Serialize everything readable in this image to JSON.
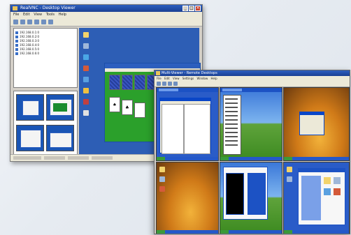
{
  "back_window": {
    "title": "RealVNC - Desktop Viewer",
    "menu": [
      "File",
      "Edit",
      "View",
      "Tools",
      "Help"
    ],
    "file_list": [
      "192.168.0.1:0",
      "192.168.0.2:0",
      "192.168.0.3:0",
      "192.168.0.4:0",
      "192.168.0.5:0",
      "192.168.0.6:0"
    ],
    "solitaire_cards": [
      "",
      "",
      "",
      "",
      "♥",
      "♦",
      "♠",
      "♣"
    ]
  },
  "front_window": {
    "title": "Multi-Viewer - Remote Desktops",
    "menu": [
      "File",
      "Edit",
      "View",
      "Settings",
      "Window",
      "Help"
    ],
    "panes": [
      "pane-1",
      "pane-2",
      "pane-3",
      "pane-4",
      "pane-5",
      "pane-6"
    ]
  },
  "colors": {
    "xp_blue": "#2d5fbf",
    "xp_desktop": "#2a5cc8",
    "bliss_green": "#3c8a20",
    "autumn_orange": "#d07a18",
    "solitaire_green": "#2ba02b"
  }
}
